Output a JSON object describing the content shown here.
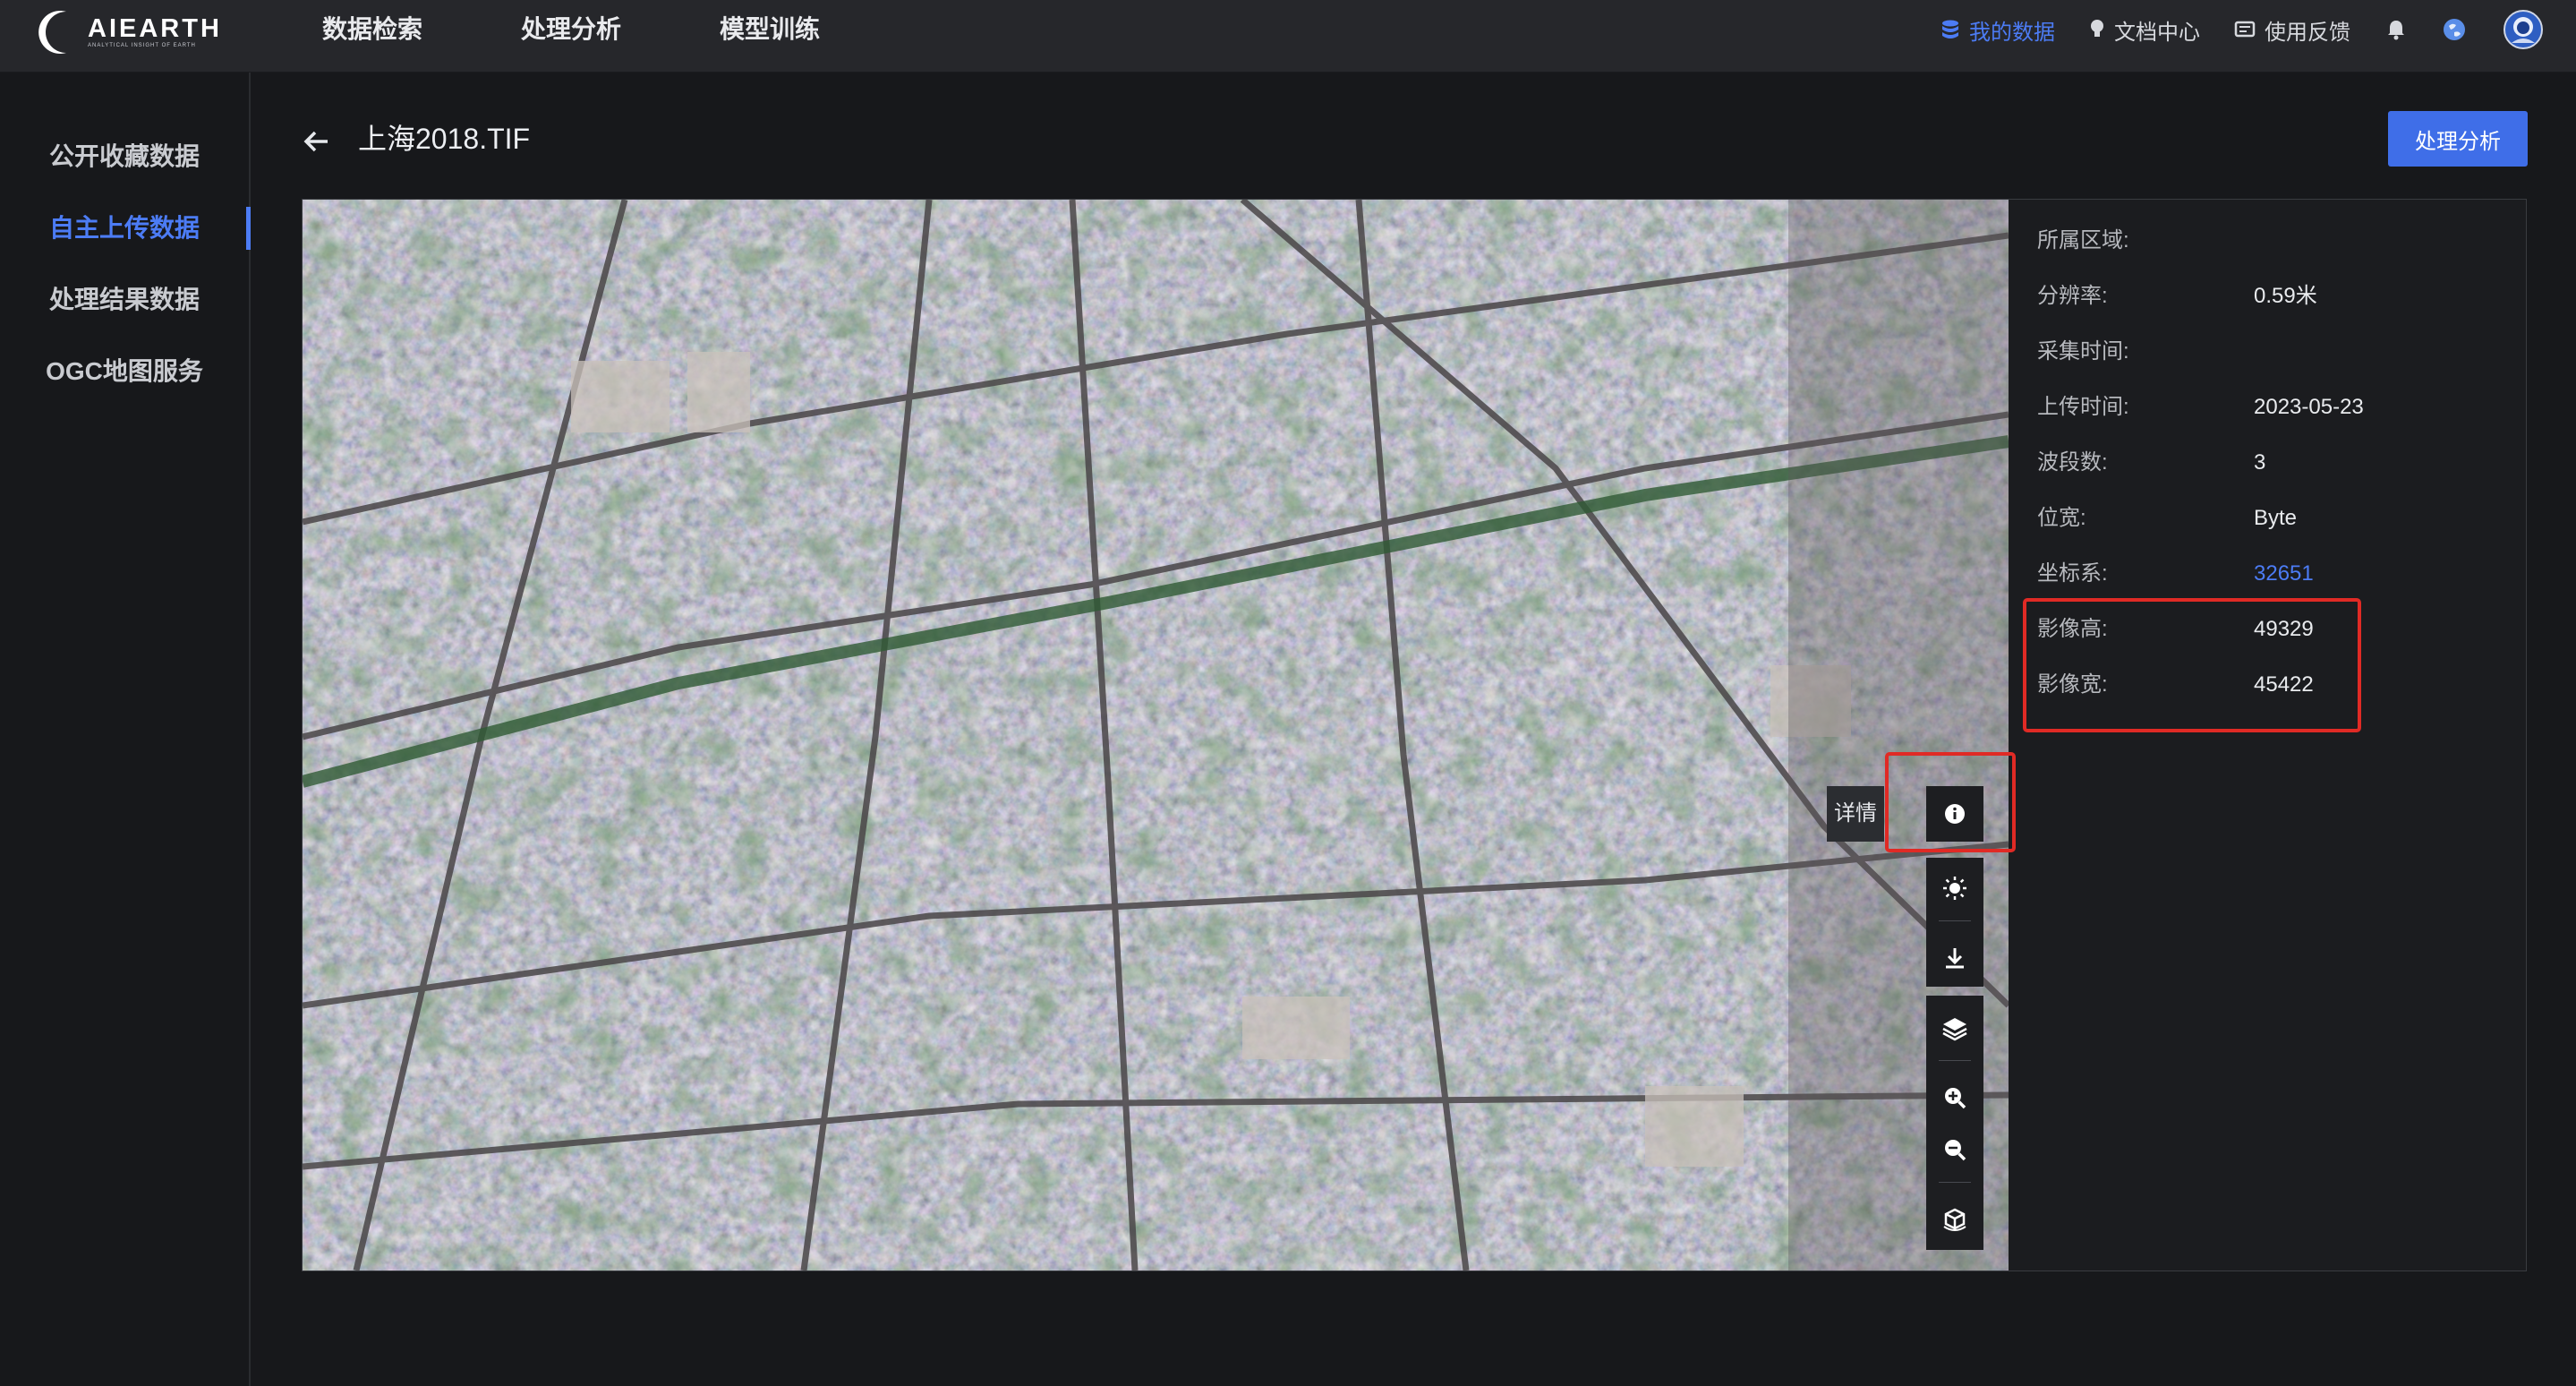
{
  "brand": {
    "name": "AIEARTH",
    "tagline": "ANALYTICAL INSIGHT OF EARTH"
  },
  "nav": {
    "items": [
      "数据检索",
      "处理分析",
      "模型训练"
    ]
  },
  "header_right": {
    "my_data": "我的数据",
    "docs": "文档中心",
    "feedback": "使用反馈"
  },
  "sidebar": {
    "items": [
      "公开收藏数据",
      "自主上传数据",
      "处理结果数据",
      "OGC地图服务"
    ],
    "active_index": 1
  },
  "page": {
    "title": "上海2018.TIF",
    "process_button": "处理分析"
  },
  "viewer": {
    "tooltip": "详情",
    "tools": [
      "info-icon",
      "brightness-icon",
      "download-icon",
      "layers-icon",
      "zoom-in-icon",
      "zoom-out-icon",
      "3d-cube-icon"
    ]
  },
  "info": {
    "rows": [
      {
        "key": "所属区域:",
        "value": ""
      },
      {
        "key": "分辨率:",
        "value": "0.59米"
      },
      {
        "key": "采集时间:",
        "value": ""
      },
      {
        "key": "上传时间:",
        "value": "2023-05-23"
      },
      {
        "key": "波段数:",
        "value": "3"
      },
      {
        "key": "位宽:",
        "value": "Byte"
      },
      {
        "key": "坐标系:",
        "value": "32651"
      },
      {
        "key": "影像高:",
        "value": "49329"
      },
      {
        "key": "影像宽:",
        "value": "45422"
      }
    ]
  },
  "colors": {
    "accent": "#3f6ee8",
    "link": "#4c7cf5",
    "highlight": "#e02a25",
    "topbar": "#26272b",
    "background": "#17181b"
  }
}
